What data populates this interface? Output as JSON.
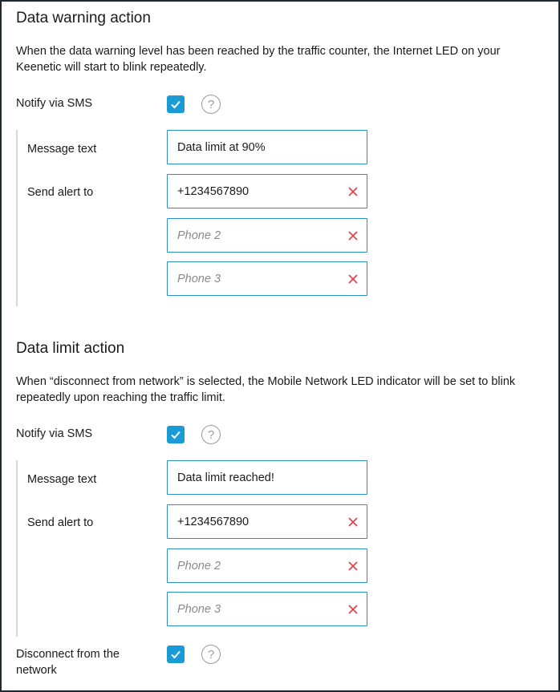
{
  "warning": {
    "title": "Data warning action",
    "description": "When the data warning level has been reached by the traffic counter, the Internet LED on your Keenetic will start to blink repeatedly.",
    "notify_label": "Notify via SMS",
    "message_label": "Message text",
    "message_value": "Data limit at 90%",
    "send_label": "Send alert to",
    "phone1_value": "+1234567890",
    "phone2_placeholder": "Phone 2",
    "phone3_placeholder": "Phone 3"
  },
  "limit": {
    "title": "Data limit action",
    "description": "When “disconnect from network” is selected, the Mobile Network LED indicator will be set to blink repeatedly upon reaching the traffic limit.",
    "notify_label": "Notify via SMS",
    "message_label": "Message text",
    "message_value": "Data limit reached!",
    "send_label": "Send alert to",
    "phone1_value": "+1234567890",
    "phone2_placeholder": "Phone 2",
    "phone3_placeholder": "Phone 3",
    "disconnect_label": "Disconnect from the network"
  },
  "help_glyph": "?",
  "colors": {
    "accent": "#1a9bd6",
    "clear": "#e0484f",
    "border": "#2a8fc4"
  }
}
